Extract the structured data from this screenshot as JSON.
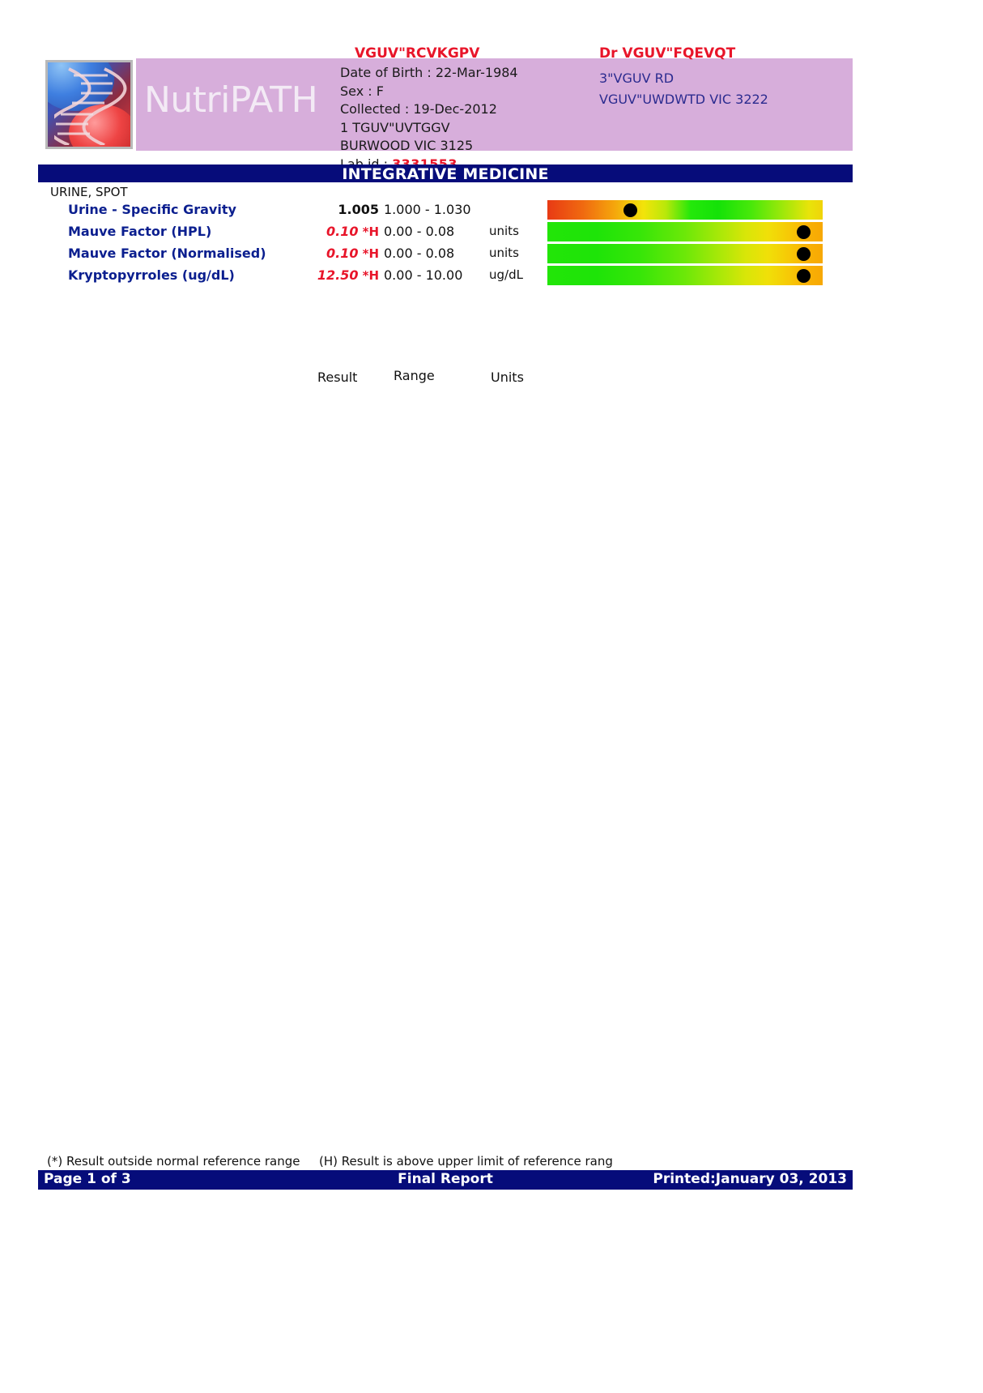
{
  "report": {
    "brand": "NutriPATH",
    "section_title": "INTEGRATIVE MEDICINE",
    "specimen_label": "URINE, SPOT"
  },
  "patient": {
    "name": "VGUV\"RCVKGPV",
    "dob_line": "Date of Birth :  22-Mar-1984",
    "sex_line": "Sex : F",
    "collected_line": "Collected :  19-Dec-2012",
    "address_line1": "1  TGUV\"UVTGGV",
    "address_line2": "BURWOOD VIC 3125",
    "lab_id_label": "Lab id : ",
    "lab_id_value": "3331553"
  },
  "doctor": {
    "prefix": "Dr ",
    "name": "VGUV\"FQEVQT",
    "address_line1": "3\"VGUV RD",
    "address_line2": "VGUV\"UWDWTD VIC 3222"
  },
  "columns": {
    "result": "Result",
    "range": "Range",
    "units": "Units"
  },
  "results": [
    {
      "test": "Urine - Specific Gravity",
      "value": "1.005",
      "flag": "",
      "range": "1.000 - 1.030",
      "units": "",
      "abnormal": false,
      "bar_style": "normal-center",
      "marker_pct": 30
    },
    {
      "test": "Mauve Factor (HPL)",
      "value": "0.10",
      "flag": "*H",
      "range": "0.00 - 0.08",
      "units": "units",
      "abnormal": true,
      "bar_style": "low-good",
      "marker_pct": 93
    },
    {
      "test": "Mauve Factor (Normalised)",
      "value": "0.10",
      "flag": "*H",
      "range": "0.00 - 0.08",
      "units": "units",
      "abnormal": true,
      "bar_style": "low-good",
      "marker_pct": 93
    },
    {
      "test": "Kryptopyrroles (ug/dL)",
      "value": "12.50",
      "flag": "*H",
      "range": "0.00 - 10.00",
      "units": "ug/dL",
      "abnormal": true,
      "bar_style": "low-good",
      "marker_pct": 93
    }
  ],
  "footnotes": {
    "asterisk": "(*) Result outside normal reference range",
    "high": "(H) Result is above upper limit of reference rang"
  },
  "footer": {
    "page": "Page 1 of 3",
    "status": "Final Report",
    "printed": "Printed:January 03, 2013"
  },
  "colors": {
    "header_band": "#d7aedb",
    "navy": "#060c7a",
    "red": "#e8152a",
    "blue_text": "#0b1f8f",
    "doctor_blue": "#2b2b8f"
  }
}
